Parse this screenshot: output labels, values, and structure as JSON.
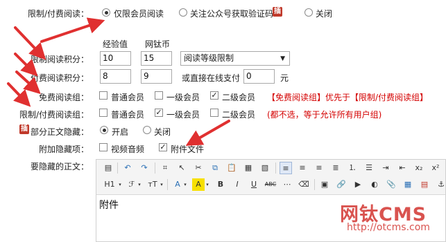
{
  "labels": {
    "read_limit": "限制/付费阅读：",
    "limit_points": "限制阅读积分：",
    "pay_points": "付费阅读积分：",
    "free_group": "免费阅读组：",
    "limit_group": "限制/付费阅读组：",
    "partial_hide": "部分正文隐藏：",
    "extra_hide": "附加隐藏项：",
    "hidden_body": "要隐藏的正文："
  },
  "read_mode": {
    "options": [
      "仅限会员阅读",
      "关注公众号获取验证码",
      "关闭"
    ],
    "selected": 0,
    "badge": "插"
  },
  "columns": {
    "exp": "经验值",
    "coin": "网钛币"
  },
  "limit_row": {
    "exp": "10",
    "coin": "15",
    "select": "阅读等级限制"
  },
  "pay_row": {
    "exp": "8",
    "coin": "9",
    "or_text": "或直接在线支付",
    "pay": "0",
    "unit": "元"
  },
  "free_group": {
    "options": [
      {
        "label": "普通会员",
        "checked": false
      },
      {
        "label": "一级会员",
        "checked": false
      },
      {
        "label": "二级会员",
        "checked": true
      }
    ],
    "note": "【免费阅读组】优先于【限制/付费阅读组】"
  },
  "limit_group": {
    "options": [
      {
        "label": "普通会员",
        "checked": false
      },
      {
        "label": "一级会员",
        "checked": true
      },
      {
        "label": "二级会员",
        "checked": false
      }
    ],
    "note": "(都不选，等于允许所有用户组)"
  },
  "partial_hide": {
    "badge": "插",
    "options": [
      "开启",
      "关闭"
    ],
    "selected": 0
  },
  "extra_hide": {
    "options": [
      {
        "label": "视频音频",
        "checked": false
      },
      {
        "label": "附件文件",
        "checked": true
      }
    ]
  },
  "editor": {
    "row2_text": {
      "heading": "H1",
      "font": "ℱ",
      "size": "тT",
      "bold": "B",
      "italic": "I",
      "underline": "U",
      "strike": "ABC"
    },
    "content": "附件"
  },
  "watermark": {
    "brand": "网钛CMS",
    "url": "http://otcms.com"
  },
  "colors": {
    "accent": "#d40000",
    "badge": "#c0392b",
    "arrow": "#e03030"
  }
}
